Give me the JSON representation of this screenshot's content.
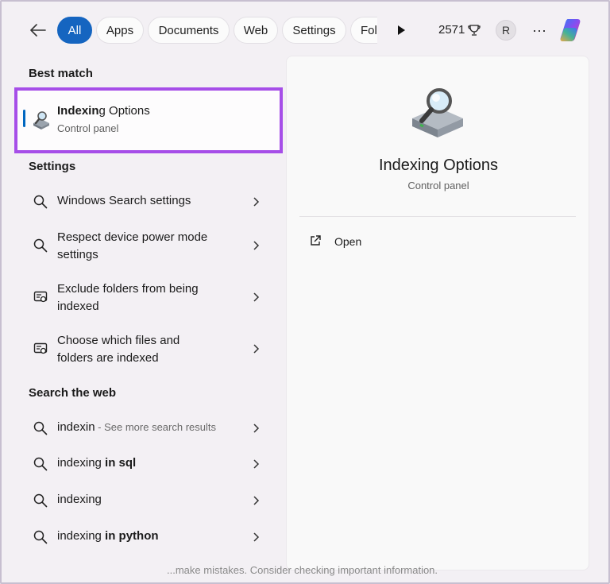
{
  "topbar": {
    "filters": [
      {
        "label": "All",
        "active": true
      },
      {
        "label": "Apps",
        "active": false
      },
      {
        "label": "Documents",
        "active": false
      },
      {
        "label": "Web",
        "active": false
      },
      {
        "label": "Settings",
        "active": false
      },
      {
        "label": "Fold",
        "active": false
      }
    ],
    "points": "2571",
    "avatar_initial": "R",
    "more_label": "···"
  },
  "best_match": {
    "heading": "Best match",
    "title_prefix": "Indexin",
    "title_rest": "g Options",
    "subtitle": "Control panel",
    "icon": "indexing-options-icon"
  },
  "settings": {
    "heading": "Settings",
    "items": [
      {
        "line1": "Windows Search settings",
        "line2": "",
        "icon": "search-icon"
      },
      {
        "line1": "Respect device power mode",
        "line2": "settings",
        "icon": "search-icon"
      },
      {
        "line1": "Exclude folders from being",
        "line2": "indexed",
        "icon": "settings-panel-icon"
      },
      {
        "line1": "Choose which files and",
        "line2": "folders are indexed",
        "icon": "settings-panel-icon"
      }
    ]
  },
  "web": {
    "heading": "Search the web",
    "items": [
      {
        "prefix": "indexin",
        "rest": "",
        "suffix": " - See more search results"
      },
      {
        "prefix": "indexing",
        "rest": " in sql",
        "suffix": ""
      },
      {
        "prefix": "indexing",
        "rest": "",
        "suffix": ""
      },
      {
        "prefix": "indexing",
        "rest": " in python",
        "suffix": ""
      }
    ]
  },
  "preview": {
    "title": "Indexing Options",
    "subtitle": "Control panel",
    "actions": [
      {
        "label": "Open",
        "icon": "open-external-icon"
      }
    ]
  },
  "footer_hint": "...make mistakes. Consider checking important information.",
  "colors": {
    "accent": "#1565c0",
    "highlight_border": "#a64ee8"
  }
}
